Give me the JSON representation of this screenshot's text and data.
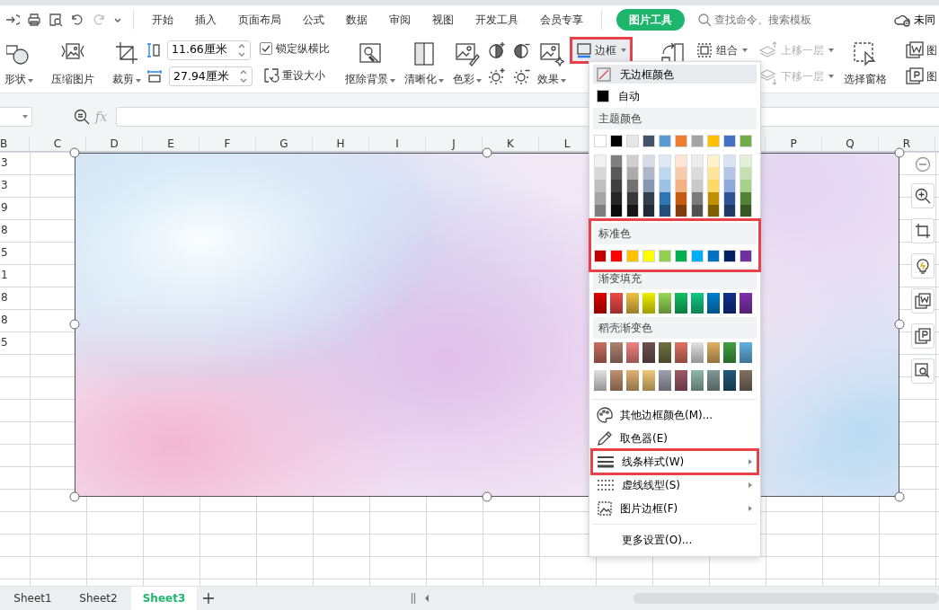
{
  "menu_tabs": [
    {
      "label": "开始",
      "selected": false
    },
    {
      "label": "插入",
      "selected": false
    },
    {
      "label": "页面布局",
      "selected": false
    },
    {
      "label": "公式",
      "selected": false
    },
    {
      "label": "数据",
      "selected": false
    },
    {
      "label": "审阅",
      "selected": false
    },
    {
      "label": "视图",
      "selected": false
    },
    {
      "label": "开发工具",
      "selected": false
    },
    {
      "label": "会员专享",
      "selected": false
    },
    {
      "label": "图片工具",
      "selected": true
    }
  ],
  "search": {
    "placeholder": "查找命令、搜索模板"
  },
  "account": {
    "label": "未同"
  },
  "ribbon": {
    "shape": {
      "label": "形状"
    },
    "compress": {
      "label": "压缩图片"
    },
    "crop": {
      "label": "裁剪"
    },
    "height": {
      "value": "11.66厘米"
    },
    "width": {
      "value": "27.94厘米"
    },
    "lock_ratio": {
      "label": "锁定纵横比",
      "checked": true
    },
    "reset_size": {
      "label": "重设大小"
    },
    "image_tools": [
      {
        "label": "抠除背景"
      },
      {
        "label": "清晰化"
      },
      {
        "label": "色彩"
      }
    ],
    "effects": {
      "label": "效果"
    },
    "border": {
      "label": "边框",
      "annotated": true
    },
    "group": {
      "label": "组合"
    },
    "arrange": [
      {
        "label": "上移一层",
        "disabled": true
      },
      {
        "label": "下移一层",
        "disabled": true
      }
    ],
    "selection_pane": {
      "label": "选择窗格"
    },
    "picture_buttons": [
      {
        "label": "图"
      },
      {
        "label": "图"
      }
    ]
  },
  "formula_bar": {
    "function_label": "fx"
  },
  "columns": [
    "B",
    "C",
    "D",
    "E",
    "F",
    "G",
    "H",
    "I",
    "J",
    "K",
    "L"
  ],
  "columns_right": [
    "P",
    "Q",
    "R"
  ],
  "column_b": [
    "3",
    "3",
    "9",
    "8",
    "5",
    "1",
    "8",
    "8",
    "5"
  ],
  "border_menu": {
    "sections": [
      {
        "kind": "option",
        "label": "无边框颜色",
        "highlighted": true
      },
      {
        "kind": "option",
        "label": "自动",
        "color": "#000000",
        "highlighted": false
      },
      {
        "kind": "palette",
        "title": "主题颜色",
        "annotated": false,
        "rows": [
          [
            {
              "color": "#ffffff"
            },
            {
              "color": "#000000"
            },
            {
              "color": "#e7e6e6"
            },
            {
              "color": "#44546a"
            },
            {
              "color": "#5b9bd5"
            },
            {
              "color": "#ed7d31"
            },
            {
              "color": "#a5a5a5"
            },
            {
              "color": "#ffc000"
            },
            {
              "color": "#4472c4"
            },
            {
              "color": "#70ad47"
            }
          ]
        ],
        "shades": [
          [
            {
              "color": "#f2f2f2"
            },
            {
              "color": "#7f7f7f"
            },
            {
              "color": "#d0cece"
            },
            {
              "color": "#d6dce4"
            },
            {
              "color": "#deebf6"
            },
            {
              "color": "#fbe5d5"
            },
            {
              "color": "#ededed"
            },
            {
              "color": "#fff2cc"
            },
            {
              "color": "#d9e2f3"
            },
            {
              "color": "#e2efd9"
            }
          ],
          [
            {
              "color": "#d8d8d8"
            },
            {
              "color": "#595959"
            },
            {
              "color": "#aeabab"
            },
            {
              "color": "#adb9ca"
            },
            {
              "color": "#bdd7ee"
            },
            {
              "color": "#f7cbac"
            },
            {
              "color": "#dbdbdb"
            },
            {
              "color": "#fee599"
            },
            {
              "color": "#b4c6e7"
            },
            {
              "color": "#c5e0b3"
            }
          ],
          [
            {
              "color": "#bfbfbf"
            },
            {
              "color": "#3f3f3f"
            },
            {
              "color": "#757070"
            },
            {
              "color": "#8496b0"
            },
            {
              "color": "#9cc3e5"
            },
            {
              "color": "#f4b183"
            },
            {
              "color": "#c9c9c9"
            },
            {
              "color": "#ffd965"
            },
            {
              "color": "#8eaadb"
            },
            {
              "color": "#a8d08d"
            }
          ],
          [
            {
              "color": "#a5a5a5"
            },
            {
              "color": "#262626"
            },
            {
              "color": "#3a3838"
            },
            {
              "color": "#323f4f"
            },
            {
              "color": "#2e75b5"
            },
            {
              "color": "#c55a11"
            },
            {
              "color": "#7b7b7b"
            },
            {
              "color": "#bf9000"
            },
            {
              "color": "#2f5496"
            },
            {
              "color": "#538135"
            }
          ],
          [
            {
              "color": "#7f7f7f"
            },
            {
              "color": "#0c0c0c"
            },
            {
              "color": "#171616"
            },
            {
              "color": "#222a35"
            },
            {
              "color": "#1e4e79"
            },
            {
              "color": "#833c0b"
            },
            {
              "color": "#525252"
            },
            {
              "color": "#7f6000"
            },
            {
              "color": "#1f3864"
            },
            {
              "color": "#375623"
            }
          ]
        ]
      },
      {
        "kind": "palette",
        "title": "标准色",
        "annotated": true,
        "rows": [
          [
            {
              "color": "#c00000"
            },
            {
              "color": "#ff0000"
            },
            {
              "color": "#ffc000"
            },
            {
              "color": "#ffff00"
            },
            {
              "color": "#92d050"
            },
            {
              "color": "#00b050"
            },
            {
              "color": "#00b0f0"
            },
            {
              "color": "#0070c0"
            },
            {
              "color": "#002060"
            },
            {
              "color": "#7030a0"
            }
          ]
        ]
      },
      {
        "kind": "gradients",
        "title": "渐变填充",
        "rows": [
          [
            {
              "color": "#e00000"
            },
            {
              "color": "#f04848"
            },
            {
              "color": "#f0c040"
            },
            {
              "color": "#f0f000"
            },
            {
              "color": "#98d858"
            },
            {
              "color": "#10c060"
            },
            {
              "color": "#10c880"
            },
            {
              "color": "#0080d0"
            },
            {
              "color": "#103090"
            },
            {
              "color": "#8030b0"
            }
          ]
        ]
      },
      {
        "kind": "gradients",
        "title": "稻壳渐变色",
        "rows": [
          [
            {
              "color": "#c87060"
            },
            {
              "color": "#b08070"
            },
            {
              "color": "#f08080"
            },
            {
              "color": "#705050"
            },
            {
              "color": "#707040"
            },
            {
              "color": "#e07060"
            },
            {
              "color": "#e2e2e2"
            },
            {
              "color": "#e0b060"
            },
            {
              "color": "#40a040"
            },
            {
              "color": "#60b0e0"
            }
          ],
          [
            {
              "color": "#e2e2e2"
            },
            {
              "color": "#c09070"
            },
            {
              "color": "#e0b070"
            },
            {
              "color": "#f0c878"
            },
            {
              "color": "#a0a0b0"
            },
            {
              "color": "#a05868"
            },
            {
              "color": "#90b8a8"
            },
            {
              "color": "#809898"
            },
            {
              "color": "#205878"
            },
            {
              "color": "#807060"
            }
          ]
        ]
      },
      {
        "kind": "separator"
      },
      {
        "kind": "command",
        "label": "其他边框颜色(M)...",
        "submenu": false,
        "annotated": false
      },
      {
        "kind": "command",
        "label": "取色器(E)",
        "submenu": false,
        "annotated": false
      },
      {
        "kind": "command",
        "label": "线条样式(W)",
        "submenu": true,
        "annotated": true
      },
      {
        "kind": "command",
        "label": "虚线线型(S)",
        "submenu": true,
        "annotated": false
      },
      {
        "kind": "command",
        "label": "图片边框(F)",
        "submenu": true,
        "annotated": false
      },
      {
        "kind": "separator"
      },
      {
        "kind": "command",
        "label": "更多设置(O)...",
        "submenu": false,
        "annotated": false
      }
    ]
  },
  "sheet_tabs": [
    {
      "label": "Sheet1",
      "selected": false
    },
    {
      "label": "Sheet2",
      "selected": false
    },
    {
      "label": "Sheet3",
      "selected": true
    }
  ]
}
